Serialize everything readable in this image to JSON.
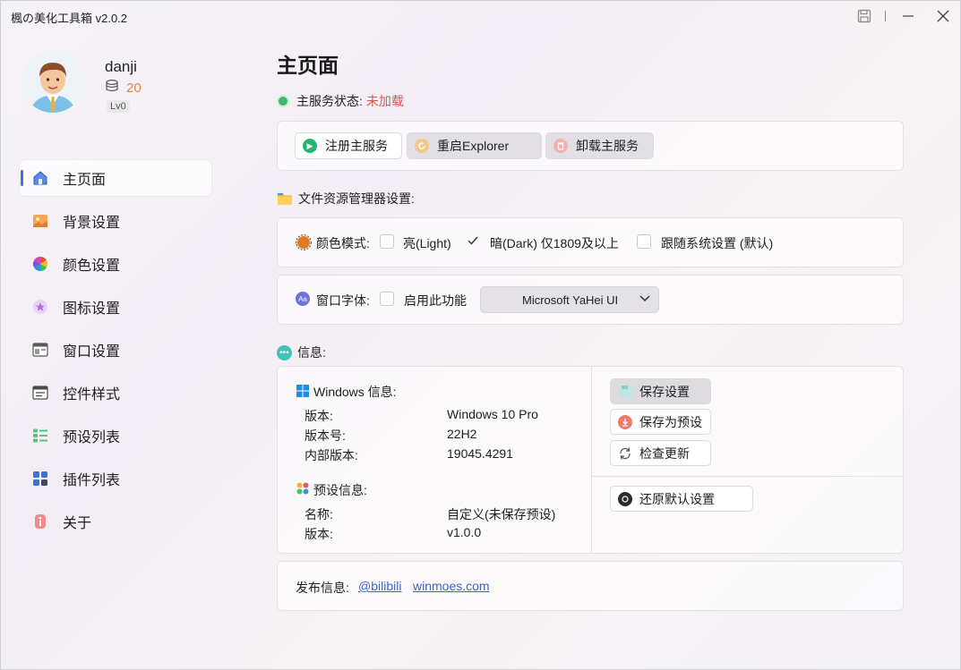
{
  "app": {
    "title": "楓の美化工具箱 v2.0.2"
  },
  "user": {
    "name": "danji",
    "coins": "20",
    "level": "Lv0"
  },
  "sidebar": {
    "items": [
      {
        "label": "主页面",
        "icon": "home-icon"
      },
      {
        "label": "背景设置",
        "icon": "image-icon"
      },
      {
        "label": "颜色设置",
        "icon": "color-wheel-icon"
      },
      {
        "label": "图标设置",
        "icon": "star-icon"
      },
      {
        "label": "窗口设置",
        "icon": "window-icon"
      },
      {
        "label": "控件样式",
        "icon": "control-icon"
      },
      {
        "label": "预设列表",
        "icon": "list-icon"
      },
      {
        "label": "插件列表",
        "icon": "plugin-icon"
      },
      {
        "label": "关于",
        "icon": "info-icon"
      }
    ]
  },
  "main": {
    "title": "主页面",
    "status_label": "主服务状态:",
    "status_value": "未加载",
    "service_buttons": {
      "register": "注册主服务",
      "restart": "重启Explorer",
      "unload": "卸载主服务"
    },
    "explorer_section": "文件资源管理器设置:",
    "color_mode": {
      "label": "颜色模式:",
      "light": "亮(Light)",
      "dark": "暗(Dark) 仅1809及以上",
      "system": "跟随系统设置 (默认)",
      "selected": "dark"
    },
    "window_font": {
      "label": "窗口字体:",
      "enable_label": "启用此功能",
      "selected_font": "Microsoft YaHei UI"
    },
    "info_section": "信息:",
    "windows_info": {
      "title": "Windows 信息:",
      "rows": [
        {
          "key": "版本:",
          "value": "Windows 10 Pro"
        },
        {
          "key": "版本号:",
          "value": "22H2"
        },
        {
          "key": "内部版本:",
          "value": "19045.4291"
        }
      ]
    },
    "preset_info": {
      "title": "预设信息:",
      "rows": [
        {
          "key": "名称:",
          "value": "自定义(未保存预设)"
        },
        {
          "key": "版本:",
          "value": "v1.0.0"
        }
      ]
    },
    "actions": {
      "save": "保存设置",
      "save_preset": "保存为预设",
      "check_update": "检查更新",
      "restore": "还原默认设置"
    },
    "release": {
      "label": "发布信息:",
      "links": [
        "@bilibili",
        "winmoes.com"
      ]
    }
  },
  "colors": {
    "accent": "#4b6cd6",
    "status_ok": "#3cb96a",
    "status_error": "#e0524e",
    "coin": "#e8843c",
    "link": "#3f63c9"
  }
}
